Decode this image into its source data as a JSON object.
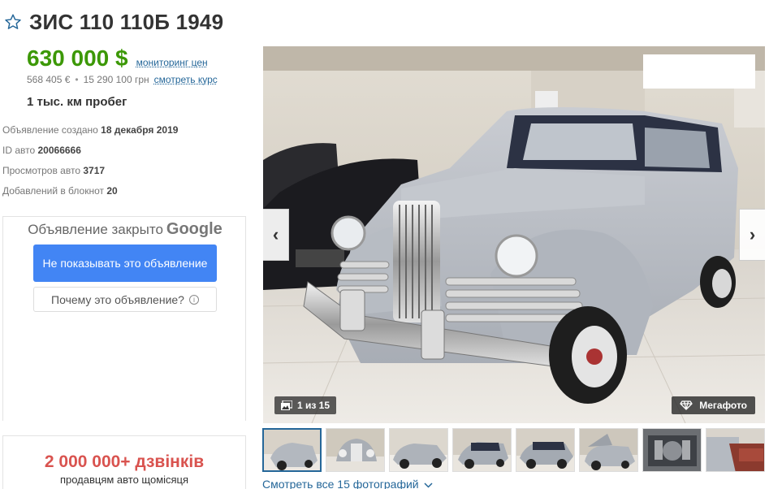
{
  "listing": {
    "title": "ЗИС 110 110Б 1949",
    "price_usd": "630 000 $",
    "price_monitor_link": "мониторинг цен",
    "price_eur": "568 405 €",
    "price_uah": "15 290 100 грн",
    "rate_link": "смотреть курс",
    "mileage": "1 тыс. км пробег"
  },
  "meta": {
    "created_label": "Объявление создано",
    "created_value": "18 декабря 2019",
    "id_label": "ID авто",
    "id_value": "20066666",
    "views_label": "Просмотров авто",
    "views_value": "3717",
    "notepad_label": "Добавлений в блокнот",
    "notepad_value": "20"
  },
  "ad": {
    "closed_text": "Объявление закрыто",
    "google": "Google",
    "hide_button": "Не показывать это объявление",
    "why_button": "Почему это объявление?"
  },
  "promo": {
    "big": "2 000 000+ дзвінків",
    "small": "продавцям авто щомісяця"
  },
  "gallery": {
    "counter": "1 из 15",
    "megafoto": "Мегафото",
    "prev": "‹",
    "next": "›",
    "see_all": "Смотреть все 15 фотографий",
    "thumb_count": 8
  },
  "colors": {
    "price_green": "#3c9806",
    "link_blue": "#256799",
    "google_blue": "#4285f4",
    "promo_red": "#d9534f"
  }
}
